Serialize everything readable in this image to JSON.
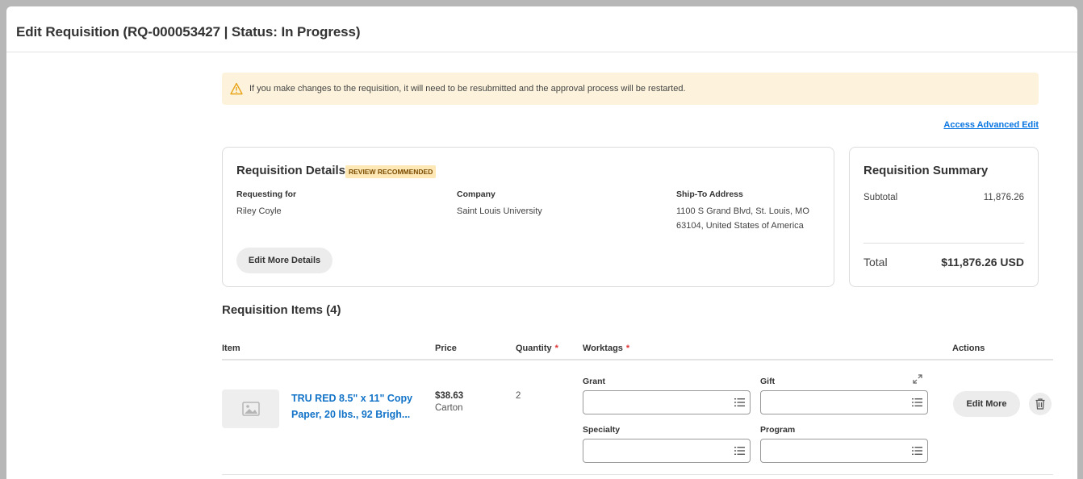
{
  "page": {
    "title": "Edit Requisition (RQ-000053427 | Status: In Progress)"
  },
  "alert": {
    "icon": "warning-icon",
    "text": "If you make changes to the requisition, it will need to be resubmitted and the approval process will be restarted."
  },
  "advanced_edit_link": "Access Advanced Edit",
  "details": {
    "title": "Requisition Details",
    "badge": "REVIEW RECOMMENDED",
    "requesting_for_label": "Requesting for",
    "requesting_for_value": "Riley Coyle",
    "company_label": "Company",
    "company_value": "Saint Louis University",
    "ship_to_label": "Ship-To Address",
    "ship_to_line1": "1100 S Grand Blvd, St. Louis, MO",
    "ship_to_line2": "63104, United States of America",
    "edit_button": "Edit More Details"
  },
  "summary": {
    "title": "Requisition Summary",
    "subtotal_label": "Subtotal",
    "subtotal_value": "11,876.26",
    "total_label": "Total",
    "total_value": "$11,876.26 USD"
  },
  "items": {
    "title": "Requisition Items (4)",
    "columns": {
      "item": "Item",
      "price": "Price",
      "quantity": "Quantity",
      "worktags": "Worktags",
      "actions": "Actions"
    },
    "required_marker": "*",
    "rows": [
      {
        "name_line1": "TRU RED 8.5\" x 11\" Copy",
        "name_line2": "Paper, 20 lbs., 92 Brigh...",
        "price": "$38.63",
        "unit": "Carton",
        "quantity": "2",
        "worktags": {
          "grant_label": "Grant",
          "gift_label": "Gift",
          "specialty_label": "Specialty",
          "program_label": "Program"
        },
        "edit_button": "Edit More"
      }
    ]
  },
  "colors": {
    "link": "#0875e1",
    "alert_bg": "#fdf3dc",
    "badge_bg": "#fde8b6",
    "required": "#dd3333"
  }
}
